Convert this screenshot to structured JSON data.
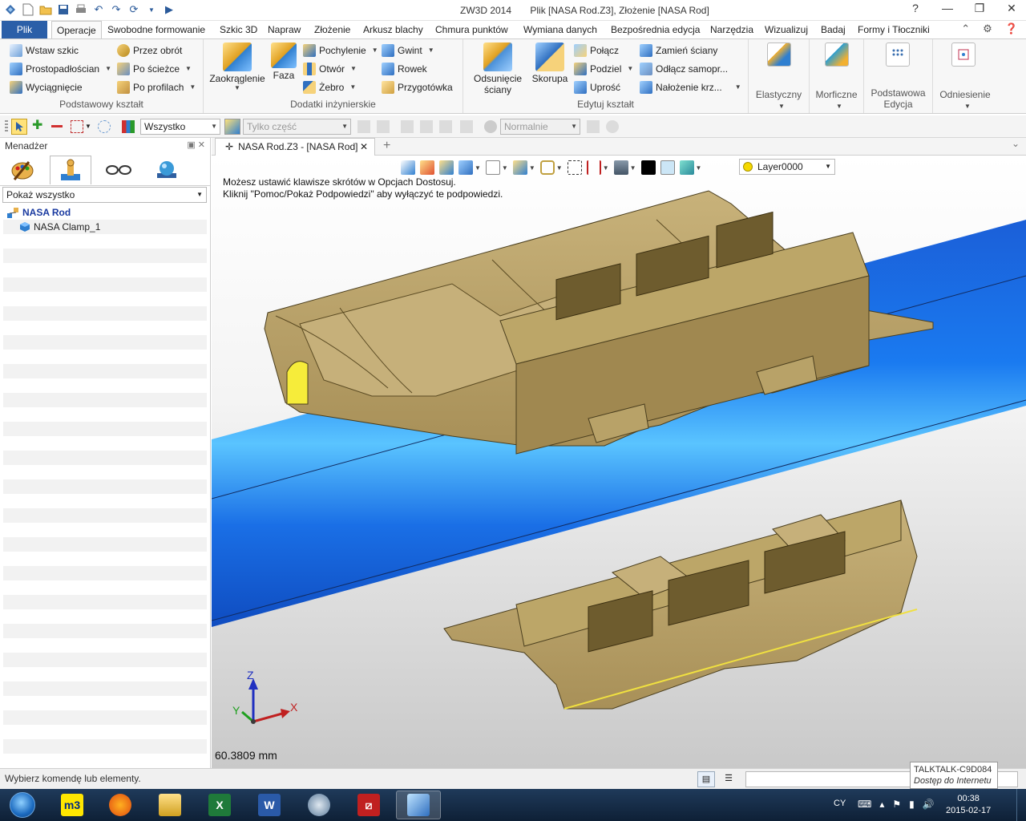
{
  "titlebar": {
    "app": "ZW3D 2014",
    "document": "Plik [NASA Rod.Z3],  Złożenie [NASA Rod]",
    "controls": [
      "?",
      "—",
      "❐",
      "✕"
    ]
  },
  "menu": {
    "file": "Plik",
    "tabs": [
      "Operacje",
      "Swobodne formowanie",
      "Szkic 3D",
      "Napraw",
      "Złożenie",
      "Arkusz blachy",
      "Chmura punktów",
      "Wymiana danych",
      "Bezpośrednia edycja",
      "Narzędzia",
      "Wizualizuj",
      "Badaj",
      "Formy i Tłoczniki"
    ],
    "active": "Operacje"
  },
  "ribbon": {
    "basic": {
      "label": "Podstawowy kształt",
      "items": [
        "Wstaw szkic",
        "Przez obrót",
        "Prostopadłościan",
        "Po ścieżce",
        "Wyciągnięcie",
        "Po profilach"
      ]
    },
    "engineering": {
      "label": "Dodatki inżynierskie",
      "big": [
        "Zaokrąglenie",
        "Faza"
      ],
      "items": [
        "Pochylenie",
        "Gwint",
        "Otwór",
        "Rowek",
        "Żebro",
        "Przygotówka"
      ]
    },
    "edit": {
      "label": "Edytuj kształt",
      "big": [
        "Odsunięcie ściany",
        "Skorupa"
      ],
      "items": [
        "Połącz",
        "Zamień ściany",
        "Podziel",
        "Odłącz samopr...",
        "Uprość",
        "Nałożenie krz..."
      ]
    },
    "extra": [
      "Elastyczny",
      "Morficzne",
      "Podstawowa Edycja",
      "Odniesienie"
    ]
  },
  "toolbar": {
    "filter": "Wszystko",
    "part_only": "Tylko część",
    "mode": "Normalnie"
  },
  "manager": {
    "title": "Menadżer",
    "show": "Pokaż wszystko",
    "tree": [
      {
        "label": "NASA Rod",
        "bold": true
      },
      {
        "label": "NASA Clamp_1",
        "bold": false
      }
    ]
  },
  "document_tab": {
    "label": "NASA Rod.Z3 - [NASA Rod]"
  },
  "viewport": {
    "hint_line1": "Możesz ustawić klawisze skrótów w Opcjach Dostosuj.",
    "hint_line2": "Kliknij \"Pomoc/Pokaż Podpowiedzi\" aby wyłączyć te podpowiedzi.",
    "layer": "Layer0000",
    "measure": "60.3809 mm",
    "axes": {
      "x": "X",
      "y": "Y",
      "z": "Z"
    },
    "colors": {
      "rod": "#1560e0",
      "clamp": "#b09a5c",
      "clamp_dark": "#7a6a3a"
    }
  },
  "status": {
    "message": "Wybierz komendę lub elementy.",
    "network_name": "TALKTALK-C9D084",
    "network_status": "Dostęp do Internetu"
  },
  "taskbar": {
    "apps": [
      "m3",
      "Firefox",
      "Explorer",
      "Excel",
      "Word",
      "Mail",
      "Acrobat",
      "ZW3D"
    ],
    "lang": "CY",
    "time": "00:38",
    "date": "2015-02-17"
  }
}
